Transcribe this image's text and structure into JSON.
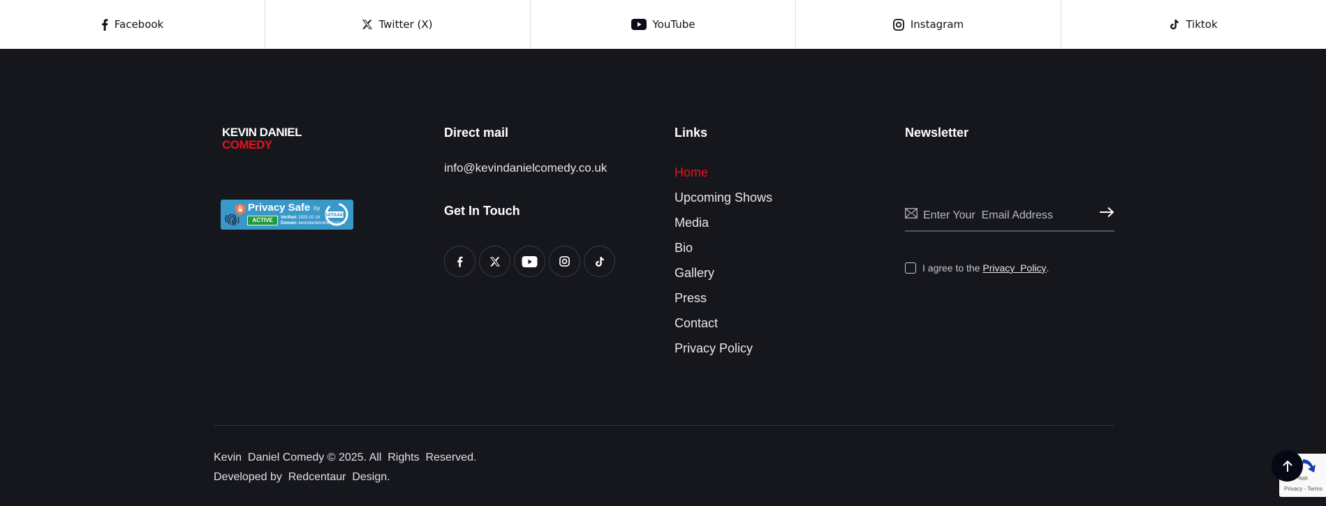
{
  "social_strip": {
    "items": [
      {
        "label": "Facebook",
        "icon": "facebook-icon"
      },
      {
        "label": "Twitter (X)",
        "icon": "x-twitter-icon"
      },
      {
        "label": "YouTube",
        "icon": "youtube-icon"
      },
      {
        "label": "Instagram",
        "icon": "instagram-icon"
      },
      {
        "label": "Tiktok",
        "icon": "tiktok-icon"
      }
    ]
  },
  "brand": {
    "line1": "KEVIN DANIEL",
    "line2": "COMEDY",
    "accent_color": "#e8121f"
  },
  "privacy_badge": {
    "title": "Privacy Safe",
    "by": "by",
    "status": "ACTIVE",
    "verified_label": "Verified:",
    "verified_date": "2025-02-16",
    "domain_label": "Domain:",
    "domain": "kevindanielcomedy.co.uk",
    "provider": "DATA443"
  },
  "direct_mail": {
    "title": "Direct mail",
    "email": "info@kevindanielcomedy.co.uk"
  },
  "get_in_touch": {
    "title": "Get In Touch",
    "icons": [
      "facebook-icon",
      "x-twitter-icon",
      "youtube-icon",
      "instagram-icon",
      "tiktok-icon"
    ]
  },
  "links": {
    "title": "Links",
    "items": [
      {
        "label": "Home",
        "active": true
      },
      {
        "label": "Upcoming Shows",
        "active": false
      },
      {
        "label": "Media",
        "active": false
      },
      {
        "label": "Bio",
        "active": false
      },
      {
        "label": "Gallery",
        "active": false
      },
      {
        "label": "Press",
        "active": false
      },
      {
        "label": "Contact",
        "active": false
      },
      {
        "label": "Privacy Policy",
        "active": false
      }
    ]
  },
  "newsletter": {
    "title": "Newsletter",
    "placeholder": "Enter Your  Email Address",
    "value": "",
    "agree_prefix": "I agree to the ",
    "agree_link": "Privacy  Policy",
    "agree_suffix": ".",
    "agree_checked": false
  },
  "bottom": {
    "copyright": "Kevin  Daniel Comedy © 2025. All  Rights  Reserved.",
    "developer": "Developed by  Redcentaur  Design."
  },
  "recaptcha": {
    "text": "Privacy - Terms"
  },
  "colors": {
    "footer_bg": "#16171c",
    "accent": "#e8121f",
    "badge_bg": "#3a98c9"
  }
}
